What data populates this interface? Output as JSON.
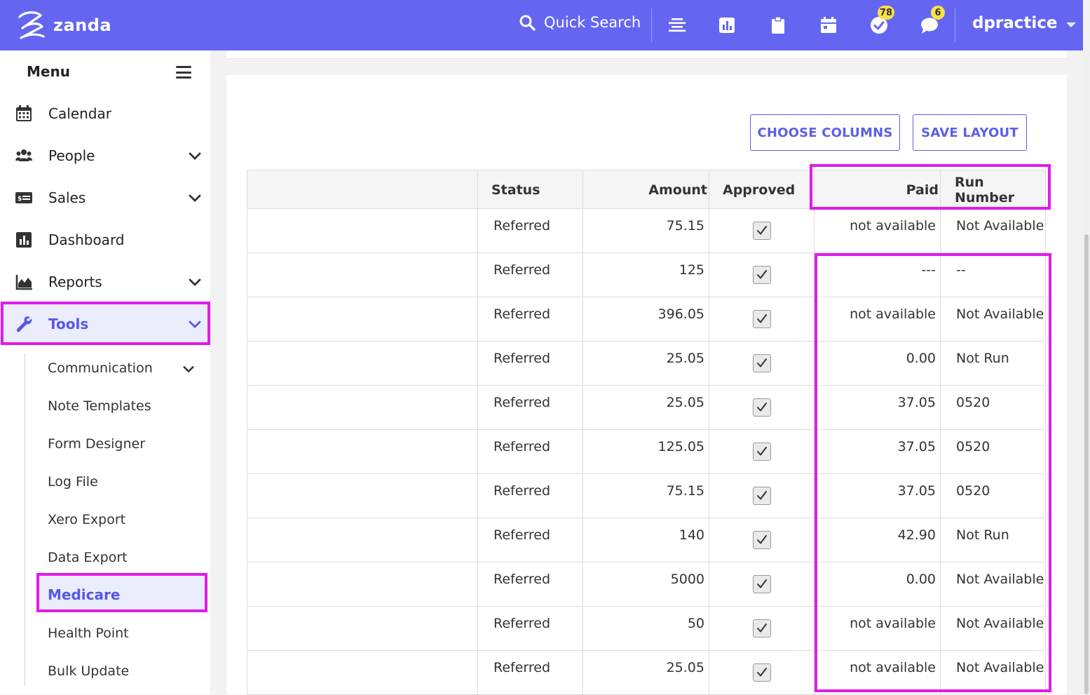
{
  "app": {
    "brand": "zanda",
    "accent": "#6466f1",
    "highlight": "#e01ce8"
  },
  "topbar": {
    "search_label": "Quick Search",
    "icons": [
      "list-icon",
      "chart-icon",
      "clipboard-icon",
      "calendar-icon",
      "tasks-check-icon",
      "chat-icon"
    ],
    "tasks_badge": "78",
    "messages_badge": "6",
    "user": "dpractice"
  },
  "sidebar": {
    "menu_label": "Menu",
    "items": [
      {
        "label": "Calendar",
        "icon": "calendar-icon"
      },
      {
        "label": "People",
        "icon": "people-icon"
      },
      {
        "label": "Sales",
        "icon": "sales-icon"
      },
      {
        "label": "Dashboard",
        "icon": "dashboard-icon"
      },
      {
        "label": "Reports",
        "icon": "reports-icon"
      },
      {
        "label": "Tools",
        "icon": "wrench-icon"
      }
    ],
    "sub_items": [
      "Communication",
      "Note Templates",
      "Form Designer",
      "Log File",
      "Xero Export",
      "Data Export",
      "Medicare",
      "Health Point",
      "Bulk Update"
    ]
  },
  "toolbar": {
    "choose_columns": "CHOOSE COLUMNS",
    "save_layout": "SAVE LAYOUT"
  },
  "table": {
    "columns": {
      "first": "",
      "status": "Status",
      "amount": "Amount",
      "approved": "Approved",
      "paid": "Paid",
      "run_number": "Run Number"
    },
    "rows": [
      {
        "status": "Referred",
        "amount": "75.15",
        "approved": true,
        "paid": "not available",
        "run": "Not Available"
      },
      {
        "status": "Referred",
        "amount": "125",
        "approved": true,
        "paid": "---",
        "run": "--"
      },
      {
        "status": "Referred",
        "amount": "396.05",
        "approved": true,
        "paid": "not available",
        "run": "Not Available"
      },
      {
        "status": "Referred",
        "amount": "25.05",
        "approved": true,
        "paid": "0.00",
        "run": "Not Run"
      },
      {
        "status": "Referred",
        "amount": "25.05",
        "approved": true,
        "paid": "37.05",
        "run": "0520"
      },
      {
        "status": "Referred",
        "amount": "125.05",
        "approved": true,
        "paid": "37.05",
        "run": "0520"
      },
      {
        "status": "Referred",
        "amount": "75.15",
        "approved": true,
        "paid": "37.05",
        "run": "0520"
      },
      {
        "status": "Referred",
        "amount": "140",
        "approved": true,
        "paid": "42.90",
        "run": "Not Run"
      },
      {
        "status": "Referred",
        "amount": "5000",
        "approved": true,
        "paid": "0.00",
        "run": "Not Available"
      },
      {
        "status": "Referred",
        "amount": "50",
        "approved": true,
        "paid": "not available",
        "run": "Not Available"
      },
      {
        "status": "Referred",
        "amount": "25.05",
        "approved": true,
        "paid": "not available",
        "run": "Not Available"
      }
    ]
  }
}
